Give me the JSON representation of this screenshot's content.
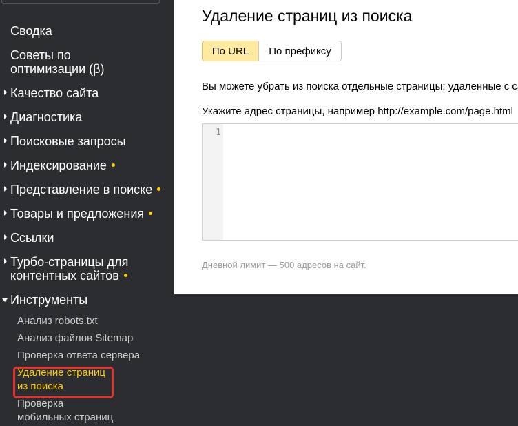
{
  "sidebar": {
    "items": [
      {
        "label": "Сводка"
      },
      {
        "label_line1": "Советы по",
        "label_line2": "оптимизации (β)"
      },
      {
        "label": "Качество сайта"
      },
      {
        "label": "Диагностика"
      },
      {
        "label": "Поисковые запросы"
      },
      {
        "label": "Индексирование"
      },
      {
        "label": "Представление в поиске"
      },
      {
        "label": "Товары и предложения"
      },
      {
        "label": "Ссылки"
      },
      {
        "label_line1": "Турбо-страницы для",
        "label_line2": "контентных сайтов"
      },
      {
        "label": "Инструменты"
      }
    ],
    "subitems": [
      {
        "label": "Анализ robots.txt"
      },
      {
        "label": "Анализ файлов Sitemap"
      },
      {
        "label": "Проверка ответа сервера"
      },
      {
        "label_line1": "Удаление страниц",
        "label_line2": "из поиска"
      },
      {
        "label_line1": "Проверка",
        "label_line2": "мобильных страниц"
      }
    ]
  },
  "main": {
    "title": "Удаление страниц из поиска",
    "tabs": [
      "По URL",
      "По префиксу"
    ],
    "description": "Вы можете убрать из поиска отдельные страницы: удаленные с са",
    "hint": "Укажите адрес страницы, например http://example.com/page.html",
    "editor": {
      "line_number": "1",
      "value": ""
    },
    "limit": "Дневной лимит — 500 адресов на сайт."
  },
  "colors": {
    "accent": "#ffcc00",
    "highlight_border": "#e5322d",
    "active_tab": "#ffeba0"
  }
}
